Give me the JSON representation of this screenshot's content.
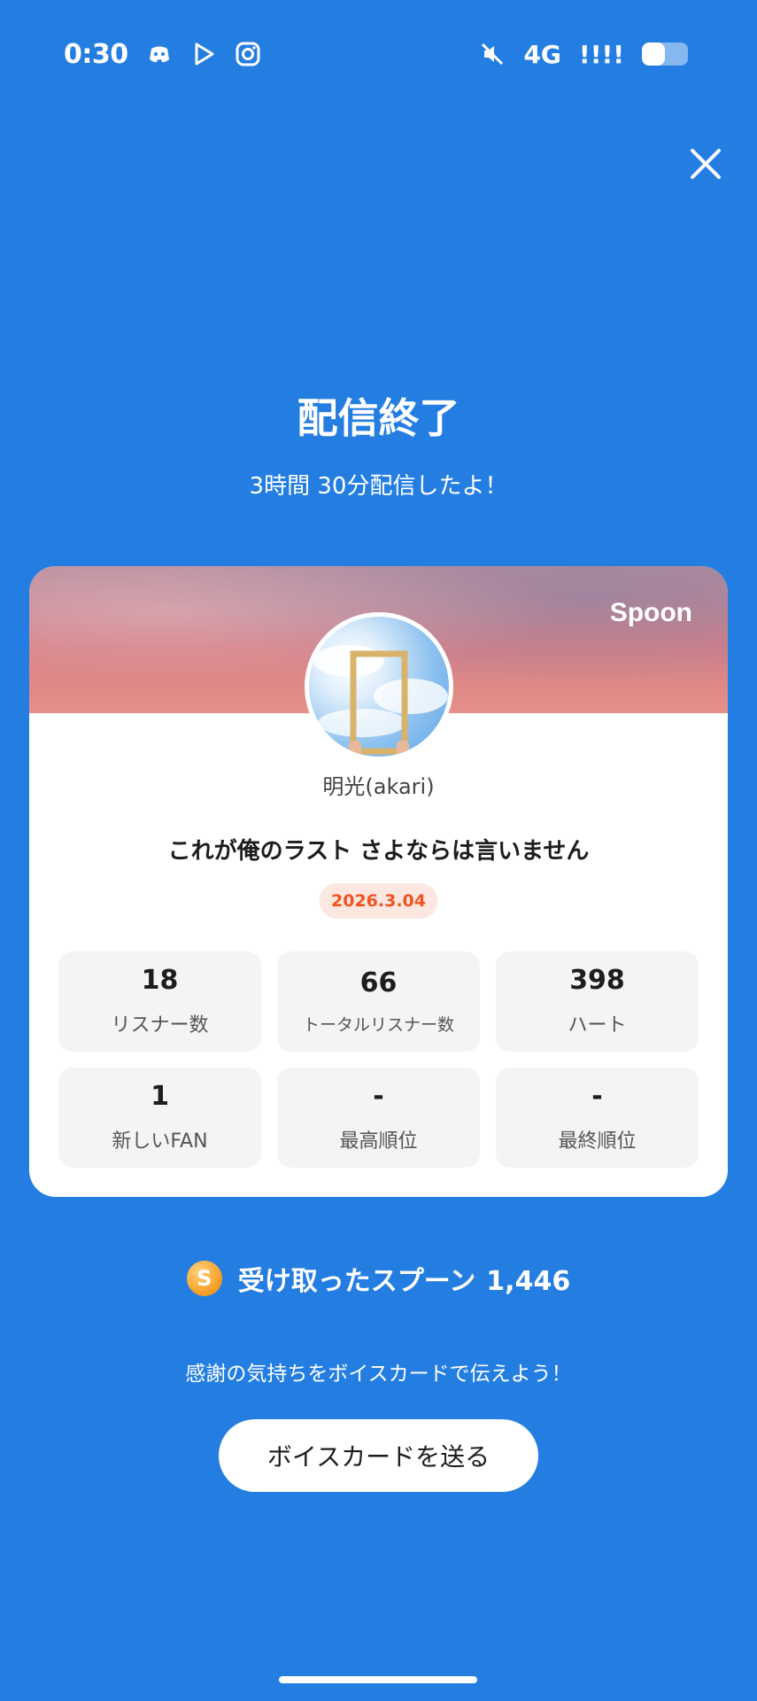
{
  "status_bar": {
    "time": "0:30",
    "network": "4G",
    "signal": "!!!!",
    "battery_level": 0.5,
    "icons": [
      "discord-icon",
      "play-store-icon",
      "instagram-icon",
      "mute-icon",
      "battery-icon"
    ]
  },
  "header": {
    "title": "配信終了",
    "subtitle": "3時間 30分配信したよ！"
  },
  "card": {
    "brand": "Spoon",
    "username": "明光(akari)",
    "live_title": "これが俺のラスト さよならは言いません",
    "date": "2026.3.04",
    "stats": [
      {
        "value": "18",
        "label": "リスナー数"
      },
      {
        "value": "66",
        "label": "トータルリスナー数"
      },
      {
        "value": "398",
        "label": "ハート"
      },
      {
        "value": "1",
        "label": "新しいFAN"
      },
      {
        "value": "-",
        "label": "最高順位"
      },
      {
        "value": "-",
        "label": "最終順位"
      }
    ]
  },
  "spoons": {
    "coin_letter": "S",
    "label": "受け取ったスプーン",
    "count": "1,446"
  },
  "thanks_text": "感謝の気持ちをボイスカードで伝えよう！",
  "voice_button_label": "ボイスカードを送る",
  "colors": {
    "background": "#247ee2",
    "date_badge_bg": "#fde7e1",
    "date_badge_text": "#ef5520",
    "spoon_coin": "#f59b23"
  }
}
